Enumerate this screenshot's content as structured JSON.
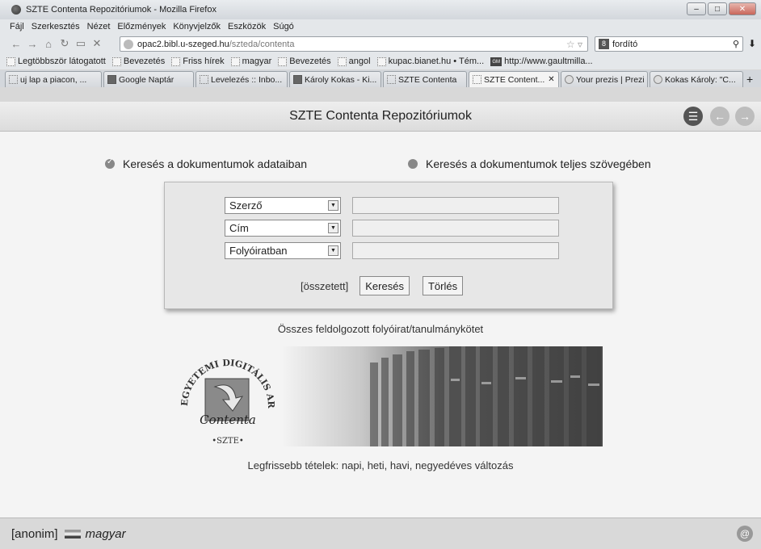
{
  "window": {
    "title": "SZTE Contenta Repozitóriumok - Mozilla Firefox"
  },
  "menu": [
    "Fájl",
    "Szerkesztés",
    "Nézet",
    "Előzmények",
    "Könyvjelzők",
    "Eszközök",
    "Súgó"
  ],
  "url": {
    "host": "opac2.bibl.u-szeged.hu",
    "path": "/szteda/contenta"
  },
  "search_engine": {
    "value": "fordító"
  },
  "bookmarks": [
    "Legtöbbször látogatott",
    "Bevezetés",
    "Friss hírek",
    "magyar",
    "Bevezetés",
    "angol",
    "kupac.bianet.hu • Tém...",
    "http://www.gaultmilla..."
  ],
  "tabs": [
    "uj lap a piacon, ...",
    "Google Naptár",
    "Levelezés :: Inbo...",
    "Károly Kokas - Ki...",
    "SZTE Contenta",
    "SZTE Content...",
    "Your prezis | Prezi",
    "Kokas Károly: \"C..."
  ],
  "page": {
    "title": "SZTE Contenta Repozitóriumok",
    "radio_metadata": "Keresés a dokumentumok adataiban",
    "radio_fulltext": "Keresés a dokumentumok teljes szövegében",
    "fields": [
      "Szerző",
      "Cím",
      "Folyóiratban"
    ],
    "advanced_link": "[összetett]",
    "search_button": "Keresés",
    "clear_button": "Törlés",
    "all_processed": "Összes feldolgozott folyóirat/tanulmánykötet",
    "logo": {
      "arc_text": "EGYETEMI DIGITÁLIS ARCHÍVUM",
      "bottom_text": "•SZTE•",
      "script_text": "Contenta"
    },
    "latest_label": "Legfrissebb tételek:",
    "latest_links": [
      "napi",
      "heti",
      "havi",
      "negyedéves"
    ],
    "latest_suffix": "változás"
  },
  "footer": {
    "user": "[anonim]",
    "language": "magyar"
  }
}
